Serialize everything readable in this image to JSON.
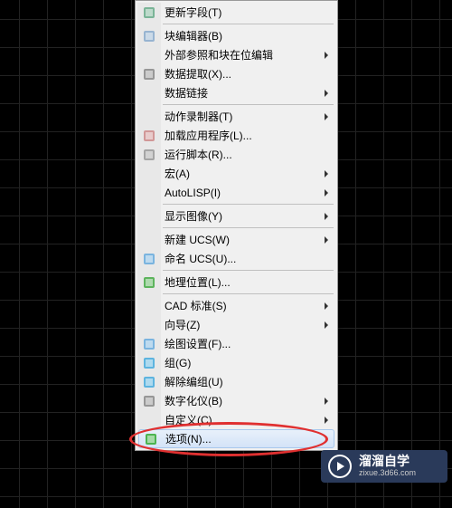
{
  "menu": {
    "items": [
      {
        "label": "更新字段(T)",
        "icon": "update-field-icon",
        "submenu": false
      },
      {
        "sep": true
      },
      {
        "label": "块编辑器(B)",
        "icon": "block-editor-icon",
        "submenu": false
      },
      {
        "label": "外部参照和块在位编辑",
        "icon": null,
        "submenu": true
      },
      {
        "label": "数据提取(X)...",
        "icon": "data-extract-icon",
        "submenu": false
      },
      {
        "label": "数据链接",
        "icon": null,
        "submenu": true
      },
      {
        "sep": true
      },
      {
        "label": "动作录制器(T)",
        "icon": null,
        "submenu": true
      },
      {
        "label": "加载应用程序(L)...",
        "icon": "load-app-icon",
        "submenu": false
      },
      {
        "label": "运行脚本(R)...",
        "icon": "run-script-icon",
        "submenu": false
      },
      {
        "label": "宏(A)",
        "icon": null,
        "submenu": true
      },
      {
        "label": "AutoLISP(I)",
        "icon": null,
        "submenu": true
      },
      {
        "sep": true
      },
      {
        "label": "显示图像(Y)",
        "icon": null,
        "submenu": true
      },
      {
        "sep": true
      },
      {
        "label": "新建 UCS(W)",
        "icon": null,
        "submenu": true
      },
      {
        "label": "命名 UCS(U)...",
        "icon": "ucs-icon",
        "submenu": false
      },
      {
        "sep": true
      },
      {
        "label": "地理位置(L)...",
        "icon": "geo-icon",
        "submenu": false
      },
      {
        "sep": true
      },
      {
        "label": "CAD 标准(S)",
        "icon": null,
        "submenu": true
      },
      {
        "label": "向导(Z)",
        "icon": null,
        "submenu": true
      },
      {
        "label": "绘图设置(F)...",
        "icon": "draft-settings-icon",
        "submenu": false
      },
      {
        "label": "组(G)",
        "icon": "group-icon",
        "submenu": false
      },
      {
        "label": "解除编组(U)",
        "icon": "ungroup-icon",
        "submenu": false
      },
      {
        "label": "数字化仪(B)",
        "icon": "tablet-icon",
        "submenu": true
      },
      {
        "label": "自定义(C)",
        "icon": null,
        "submenu": true
      },
      {
        "label": "选项(N)...",
        "icon": "options-icon",
        "submenu": false,
        "highlight": true
      }
    ]
  },
  "watermark": {
    "cn": "溜溜自学",
    "url": "zixue.3d66.com"
  },
  "icons": {
    "update-field-icon": "#6a8",
    "block-editor-icon": "#8ac",
    "data-extract-icon": "#888",
    "load-app-icon": "#c88",
    "run-script-icon": "#999",
    "ucs-icon": "#6ad",
    "geo-icon": "#4a4",
    "draft-settings-icon": "#6ad",
    "group-icon": "#4ad",
    "ungroup-icon": "#4ad",
    "tablet-icon": "#888",
    "options-icon": "#3a3"
  }
}
